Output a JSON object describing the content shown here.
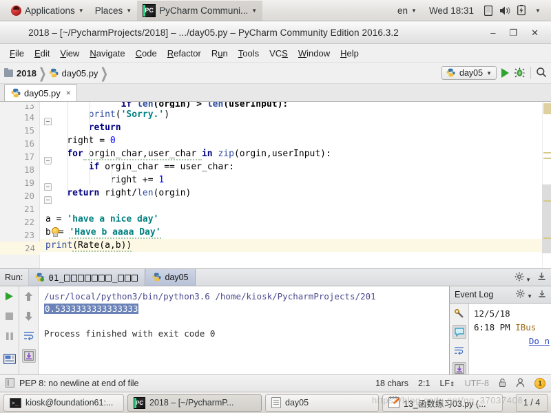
{
  "gnome_panel": {
    "apps_menu": "Applications",
    "places_menu": "Places",
    "window_menu": "PyCharm Communi...",
    "keyboard_layout": "en",
    "clock": "Wed 18:31",
    "icons": [
      "ubuntu-logo-icon",
      "display-icon",
      "volume-icon",
      "battery-icon",
      "chevron-down-icon"
    ]
  },
  "window": {
    "title": "2018 – [~/PycharmProjects/2018] – .../day05.py – PyCharm Community Edition 2016.3.2",
    "minimize": "–",
    "maximize": "❐",
    "close": "✕"
  },
  "menubar": {
    "items": [
      {
        "pre": "",
        "mn": "F",
        "post": "ile"
      },
      {
        "pre": "",
        "mn": "E",
        "post": "dit"
      },
      {
        "pre": "",
        "mn": "V",
        "post": "iew"
      },
      {
        "pre": "",
        "mn": "N",
        "post": "avigate"
      },
      {
        "pre": "",
        "mn": "C",
        "post": "ode"
      },
      {
        "pre": "",
        "mn": "R",
        "post": "efactor"
      },
      {
        "pre": "R",
        "mn": "u",
        "post": "n"
      },
      {
        "pre": "",
        "mn": "T",
        "post": "ools"
      },
      {
        "pre": "VC",
        "mn": "S",
        "post": ""
      },
      {
        "pre": "",
        "mn": "W",
        "post": "indow"
      },
      {
        "pre": "",
        "mn": "H",
        "post": "elp"
      }
    ]
  },
  "toolbar": {
    "breadcrumb_project": "2018",
    "breadcrumb_file": "day05.py",
    "run_config": "day05",
    "run_button": "run-button",
    "debug_button": "debug-button",
    "search_button": "search-everywhere-button"
  },
  "editor": {
    "tab_label": "day05.py",
    "tab_close": "×",
    "lines": [
      {
        "num": "13",
        "clipped": true
      },
      {
        "num": "14"
      },
      {
        "num": "15"
      },
      {
        "num": "16"
      },
      {
        "num": "17"
      },
      {
        "num": "18"
      },
      {
        "num": "19"
      },
      {
        "num": "20"
      },
      {
        "num": "21"
      },
      {
        "num": "22"
      },
      {
        "num": "23"
      },
      {
        "num": "24"
      }
    ],
    "code": {
      "l13": "    if len(orgin) > len(userInput):",
      "l14_indent": "        print(",
      "l14_str": "'Sorry.'",
      "l14_end": ")",
      "l15_kw": "return",
      "l16": "    right = ",
      "l16_num": "0",
      "l17_kw1": "for",
      "l17_mid": " orgin_char,user_char ",
      "l17_kw2": "in",
      "l17_fn": " zip",
      "l17_end": "(orgin,userInput):",
      "l18_kw": "if",
      "l18_rest": " orgin_char == user_char:",
      "l19": "            right += ",
      "l19_num": "1",
      "l20_kw": "return",
      "l20_mid": " right/",
      "l20_fn": "len",
      "l20_end": "(orgin)",
      "l22_var": "a = ",
      "l22_str": "'have a nice day'",
      "l23_var": "b",
      "l23_eq": "= ",
      "l23_str": "'Have b aaaa Day'",
      "l24_fn": "print",
      "l24_rest": "(Rate(a,b))"
    }
  },
  "run_window": {
    "label": "Run:",
    "tab1_prefix": "01_",
    "tab1_tofu1": 7,
    "tab1_mid": "_",
    "tab1_tofu2": 3,
    "tab2": "day05",
    "settings_icon": "gear-icon",
    "export_icon": "export-icon",
    "console": {
      "command": "/usr/local/python3/bin/python3.6 /home/kiosk/PycharmProjects/201",
      "output_selected": "0.5333333333333333",
      "exit_message": "Process finished with exit code 0"
    },
    "side_buttons": [
      "run-icon",
      "stop-icon",
      "pause-icon",
      "console-icon",
      "up-arrow-icon",
      "down-arrow-icon",
      "soft-wrap-icon",
      "scroll-to-end-icon"
    ],
    "expand": "»"
  },
  "event_log": {
    "title": "Event Log",
    "date": "12/5/18",
    "time": "6:18 PM",
    "source": "IBus",
    "link": "Do n",
    "side_buttons": [
      "settings-icon",
      "message-icon",
      "soft-wrap-icon",
      "scroll-to-end-icon"
    ],
    "expand": "»"
  },
  "statusbar": {
    "inspection": "PEP 8: no newline at end of file",
    "chars": "18 chars",
    "caret": "2:1",
    "line_sep": "LF",
    "encoding": "UTF-8",
    "lock_icon": "lock-icon",
    "user_icon": "user-icon",
    "badge": "1"
  },
  "taskbar": {
    "items": [
      {
        "label": "kiosk@foundation61:...",
        "icon": "terminal-icon",
        "active": false
      },
      {
        "label": "2018 – [~/PycharmP...",
        "icon": "pycharm-icon",
        "active": true
      },
      {
        "label": "day05",
        "icon": "file-icon",
        "active": false
      },
      {
        "label": "13_函数练习03.py (...",
        "icon": "notes-icon",
        "active": false
      }
    ],
    "workspace": "1 / 4",
    "watermark": "https://blog.csdn.net/qq_37037408"
  }
}
